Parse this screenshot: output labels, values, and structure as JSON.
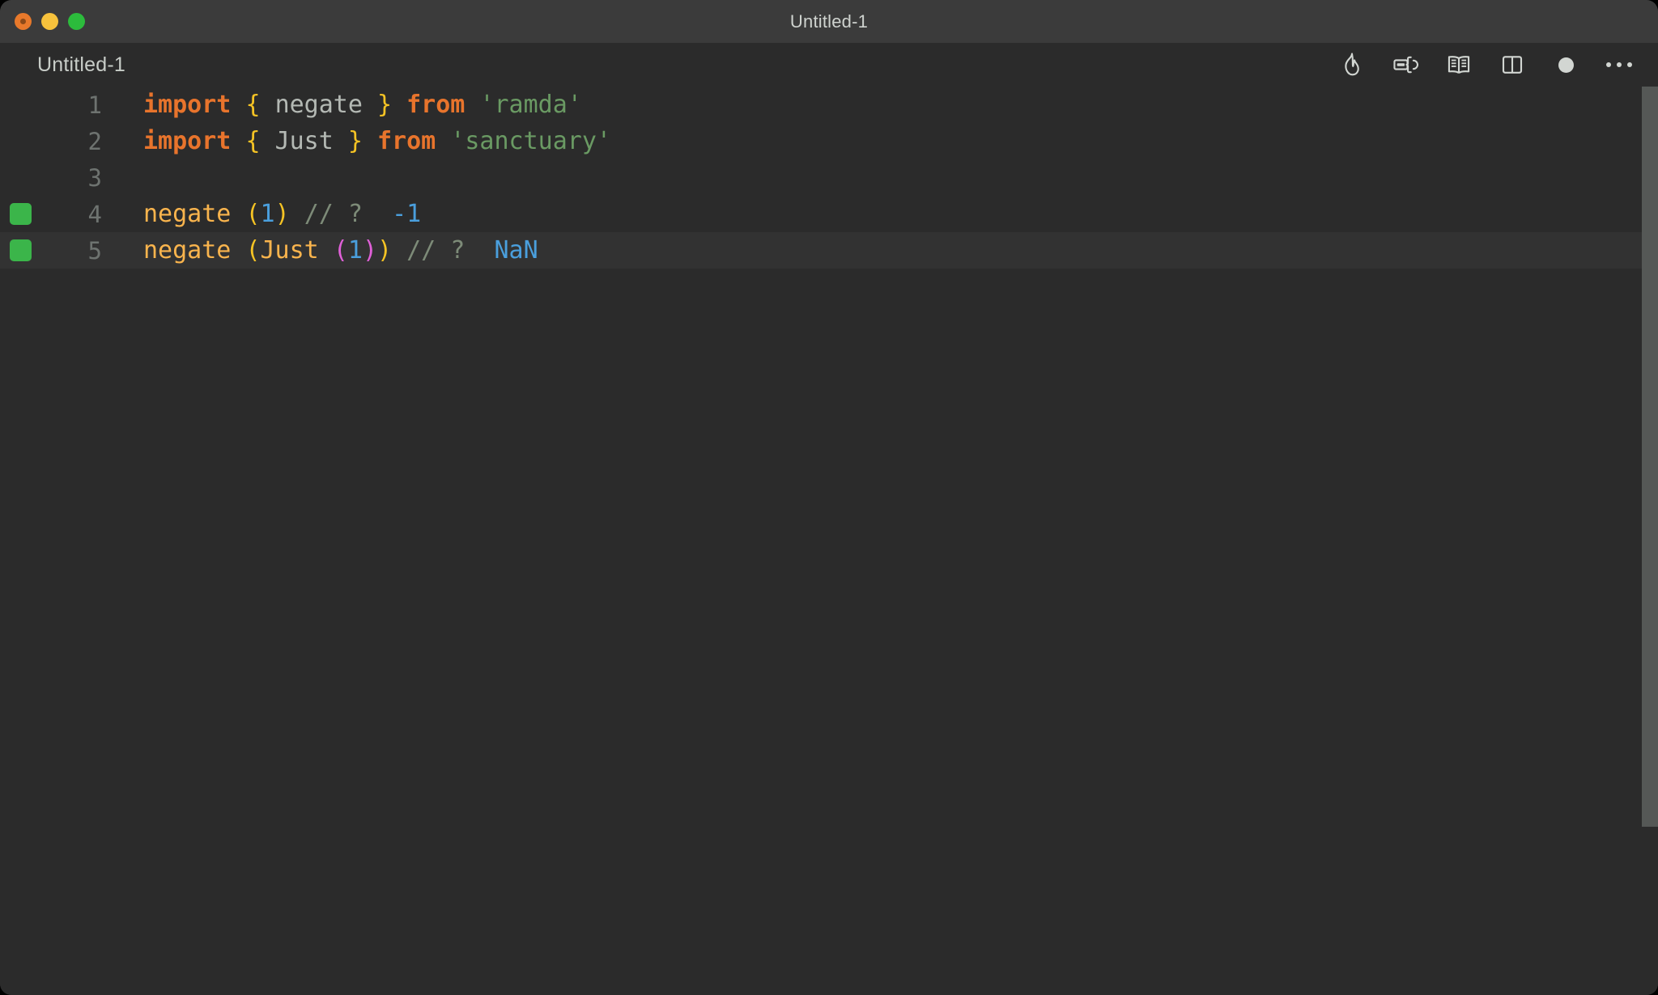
{
  "window": {
    "title": "Untitled-1",
    "traffic_lights": [
      {
        "name": "close",
        "color": "#e8792b"
      },
      {
        "name": "minimize",
        "color": "#f7c23c"
      },
      {
        "name": "maximize",
        "color": "#2cbb3c"
      }
    ]
  },
  "tabbar": {
    "tab_label": "Untitled-1",
    "toolbar_icons": [
      {
        "name": "flame-icon",
        "title": "Run / Quokka"
      },
      {
        "name": "inline-value-icon",
        "title": "Show Value"
      },
      {
        "name": "open-book-icon",
        "title": "Documentation"
      },
      {
        "name": "split-editor-icon",
        "title": "Split Editor"
      },
      {
        "name": "record-dot-icon",
        "title": "Unsaved Changes"
      },
      {
        "name": "more-actions-icon",
        "title": "More Actions"
      }
    ]
  },
  "editor": {
    "theme": {
      "background": "#2b2b2b",
      "active_line": "#323232",
      "titlebar": "#3b3b3b",
      "keyword": "#e8742c",
      "brace": "#f5c324",
      "paren_level1": "#f5c324",
      "paren_level2": "#e060d8",
      "identifier": "#b4b9b4",
      "string": "#6a9a63",
      "function": "#f9b44d",
      "number": "#4a9fdd",
      "comment": "#7d8b78",
      "result": "#4a9fdd",
      "marker": "#3bb54a",
      "linenumber": "#6e7370",
      "scrollbar": "#555856"
    },
    "lines": [
      {
        "number": "1",
        "marker": false,
        "active": false,
        "tokens": [
          {
            "text": "import",
            "type": "keyword"
          },
          {
            "text": " ",
            "type": "plain"
          },
          {
            "text": "{",
            "type": "brace"
          },
          {
            "text": " ",
            "type": "plain"
          },
          {
            "text": "negate",
            "type": "ident"
          },
          {
            "text": " ",
            "type": "plain"
          },
          {
            "text": "}",
            "type": "brace"
          },
          {
            "text": " ",
            "type": "plain"
          },
          {
            "text": "from",
            "type": "keyword"
          },
          {
            "text": " ",
            "type": "plain"
          },
          {
            "text": "'ramda'",
            "type": "string"
          }
        ]
      },
      {
        "number": "2",
        "marker": false,
        "active": false,
        "tokens": [
          {
            "text": "import",
            "type": "keyword"
          },
          {
            "text": " ",
            "type": "plain"
          },
          {
            "text": "{",
            "type": "brace"
          },
          {
            "text": " ",
            "type": "plain"
          },
          {
            "text": "Just",
            "type": "ident"
          },
          {
            "text": " ",
            "type": "plain"
          },
          {
            "text": "}",
            "type": "brace"
          },
          {
            "text": " ",
            "type": "plain"
          },
          {
            "text": "from",
            "type": "keyword"
          },
          {
            "text": " ",
            "type": "plain"
          },
          {
            "text": "'sanctuary'",
            "type": "string"
          }
        ]
      },
      {
        "number": "3",
        "marker": false,
        "active": false,
        "tokens": []
      },
      {
        "number": "4",
        "marker": true,
        "active": false,
        "tokens": [
          {
            "text": "negate",
            "type": "func"
          },
          {
            "text": " ",
            "type": "plain"
          },
          {
            "text": "(",
            "type": "paren1"
          },
          {
            "text": "1",
            "type": "num"
          },
          {
            "text": ")",
            "type": "paren1"
          },
          {
            "text": " ",
            "type": "plain"
          },
          {
            "text": "// ?",
            "type": "comment"
          },
          {
            "text": "  ",
            "type": "plain"
          },
          {
            "text": "-1",
            "type": "result"
          }
        ]
      },
      {
        "number": "5",
        "marker": true,
        "active": true,
        "tokens": [
          {
            "text": "negate",
            "type": "func"
          },
          {
            "text": " ",
            "type": "plain"
          },
          {
            "text": "(",
            "type": "paren1"
          },
          {
            "text": "Just",
            "type": "func"
          },
          {
            "text": " ",
            "type": "plain"
          },
          {
            "text": "(",
            "type": "paren2"
          },
          {
            "text": "1",
            "type": "num"
          },
          {
            "text": ")",
            "type": "paren2"
          },
          {
            "text": ")",
            "type": "paren1"
          },
          {
            "text": " ",
            "type": "plain"
          },
          {
            "text": "// ?",
            "type": "comment"
          },
          {
            "text": "  ",
            "type": "plain"
          },
          {
            "text": "NaN",
            "type": "result"
          }
        ]
      }
    ]
  }
}
